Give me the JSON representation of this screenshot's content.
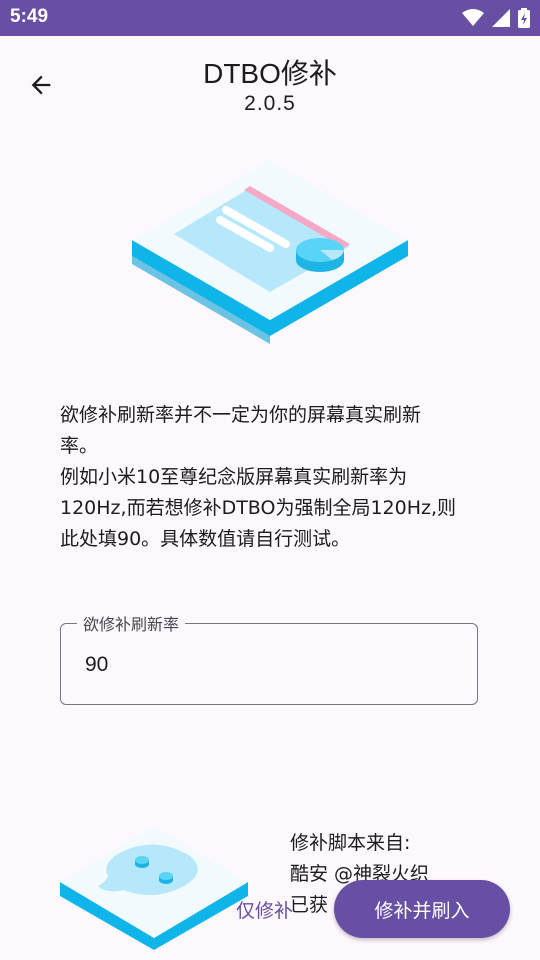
{
  "status_bar": {
    "time": "5:49",
    "icons": [
      "wifi-icon",
      "signal-icon",
      "battery-icon"
    ]
  },
  "header": {
    "title": "DTBO修补",
    "version": "2.0.5",
    "back_icon": "arrow-back-icon"
  },
  "description": {
    "lines": [
      "欲修补刷新率并不一定为你的屏幕真实刷新",
      "率。",
      "例如小米10至尊纪念版屏幕真实刷新率为",
      "120Hz,而若想修补DTBO为强制全局120Hz,则",
      "此处填90。具体数值请自行测试。"
    ]
  },
  "refresh_field": {
    "label": "欲修补刷新率",
    "value": "90"
  },
  "credit": {
    "lines": [
      "修补脚本来自:",
      "酷安 @神裂火织",
      "已获"
    ]
  },
  "actions": {
    "patch_only_label": "仅修补",
    "patch_and_flash_label": "修补并刷入"
  },
  "colors": {
    "primary": "#6750a4",
    "background": "#fdf8fd",
    "illustration_cyan": "#20b8ea"
  }
}
